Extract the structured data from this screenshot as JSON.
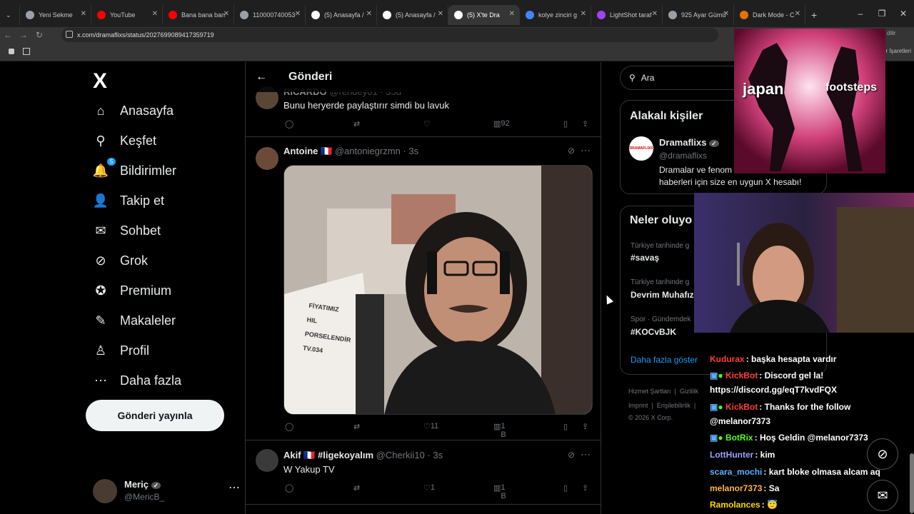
{
  "browser": {
    "tabs": [
      {
        "label": "Yeni Sekme",
        "color": "#9aa0a6"
      },
      {
        "label": "YouTube",
        "color": "#ff0000"
      },
      {
        "label": "Bana bana ban",
        "color": "#ff0000"
      },
      {
        "label": "110000740053",
        "color": "#9aa0a6"
      },
      {
        "label": "(5) Anasayfa / ",
        "color": "#ffffff"
      },
      {
        "label": "(5) Anasayfa / ",
        "color": "#ffffff"
      },
      {
        "label": "(5) X'te Dra",
        "color": "#ffffff"
      },
      {
        "label": "kolye zinciri g",
        "color": "#4285f4"
      },
      {
        "label": "LightShot taraf",
        "color": "#a142f4"
      },
      {
        "label": "925 Ayar Gümü",
        "color": "#9aa0a6"
      },
      {
        "label": "Dark Mode - C",
        "color": "#e37400"
      }
    ],
    "url": "x.com/dramaflixs/status/2027699089417359719",
    "bookmarks_text": "r İşaretleri",
    "profile_text": "dilir"
  },
  "sidebar": {
    "logo": "X",
    "items": [
      {
        "label": "Anasayfa",
        "icon": "home-icon",
        "glyph": "⌂"
      },
      {
        "label": "Keşfet",
        "icon": "search-icon",
        "glyph": "⚲"
      },
      {
        "label": "Bildirimler",
        "icon": "bell-icon",
        "glyph": "🔔",
        "badge": "5"
      },
      {
        "label": "Takip et",
        "icon": "follow-icon",
        "glyph": "👤"
      },
      {
        "label": "Sohbet",
        "icon": "mail-icon",
        "glyph": "✉"
      },
      {
        "label": "Grok",
        "icon": "grok-icon",
        "glyph": "⊘"
      },
      {
        "label": "Premium",
        "icon": "premium-icon",
        "glyph": "✪"
      },
      {
        "label": "Makaleler",
        "icon": "article-icon",
        "glyph": "✎"
      },
      {
        "label": "Profil",
        "icon": "profile-icon",
        "glyph": "♙"
      },
      {
        "label": "Daha fazla",
        "icon": "more-icon",
        "glyph": "⋯"
      }
    ],
    "post_button": "Gönderi yayınla",
    "account": {
      "name": "Meriç",
      "handle": "@MericB_"
    }
  },
  "main": {
    "title": "Gönderi",
    "posts": [
      {
        "name": "RICARDO",
        "flag": "",
        "handle": "@rendey01",
        "time": "35d",
        "text": "Bunu heryerde paylaştırır simdi bu lavuk",
        "replies": "",
        "reposts": "",
        "likes": "",
        "views": "92"
      },
      {
        "name": "Antoine",
        "flag": "🇫🇷",
        "handle": "@antoniegrzmn",
        "time": "3s",
        "text": "",
        "replies": "",
        "reposts": "",
        "likes": "11",
        "views": "1 B"
      },
      {
        "name": "Akif",
        "flag": "🇫🇷",
        "handle_prefix": "#ligekoyalım",
        "handle": "@Cherkii10",
        "time": "3s",
        "text": "W Yakup TV",
        "replies": "",
        "reposts": "",
        "likes": "1",
        "views": "1 B"
      }
    ],
    "media_sign": [
      "FİYATIMIZ",
      "HIL",
      "PORSELENDİR",
      "TV.034"
    ]
  },
  "right": {
    "search_placeholder": "Ara",
    "related": {
      "title": "Alakalı kişiler",
      "name": "Dramaflixs",
      "handle": "@dramaflixs",
      "bio_1": "Dramalar ve fenom",
      "bio_2": "haberleri için size en uygun X hesabı!",
      "avatar_text": "DRAMAFLIXS"
    },
    "trends": {
      "title": "Neler oluyo",
      "items": [
        {
          "meta": "Türkiye tarihinde g",
          "name": "#savaş"
        },
        {
          "meta": "Türkiye tarihinde g",
          "name": "Devrim Muhafız"
        },
        {
          "meta": "Spor · Gündemdek",
          "name": "#KOCvBJK"
        }
      ],
      "show_more": "Daha fazla göster"
    },
    "footer": [
      "Hizmet Şartları",
      "|",
      "Gizlilik",
      "Imprint",
      "|",
      "Erişilebilirlik",
      "|",
      "© 2026 X Corp."
    ]
  },
  "overlay": {
    "video_left_text": "japan",
    "video_right_text": "footsteps"
  },
  "chat": [
    {
      "user": "Kudurax",
      "color": "#ff3b3b",
      "msg": ": başka hesapta vardır"
    },
    {
      "user": "KickBot",
      "color": "#ff3b3b",
      "msg": ": Discord gel la!"
    },
    {
      "user": "",
      "color": "#ffffff",
      "msg": "https://discord.gg/eqT7kvdFQX"
    },
    {
      "user": "KickBot",
      "color": "#ff3b3b",
      "msg": ": Thanks for the follow"
    },
    {
      "user": "",
      "color": "#ffffff",
      "msg": "@melanor7373"
    },
    {
      "user": "BotRix",
      "color": "#53fc18",
      "msg": ": Hoş Geldin @melanor7373"
    },
    {
      "user": "LottHunter",
      "color": "#a0a0ff",
      "msg": ": kim"
    },
    {
      "user": "scara_mochi",
      "color": "#5ab0ff",
      "msg": ": kart bloke olmasa alcam aq"
    },
    {
      "user": "melanor7373",
      "color": "#ffb347",
      "msg": ": Sa"
    },
    {
      "user": "Ramolances",
      "color": "#ffd700",
      "msg": ": 😇"
    }
  ]
}
